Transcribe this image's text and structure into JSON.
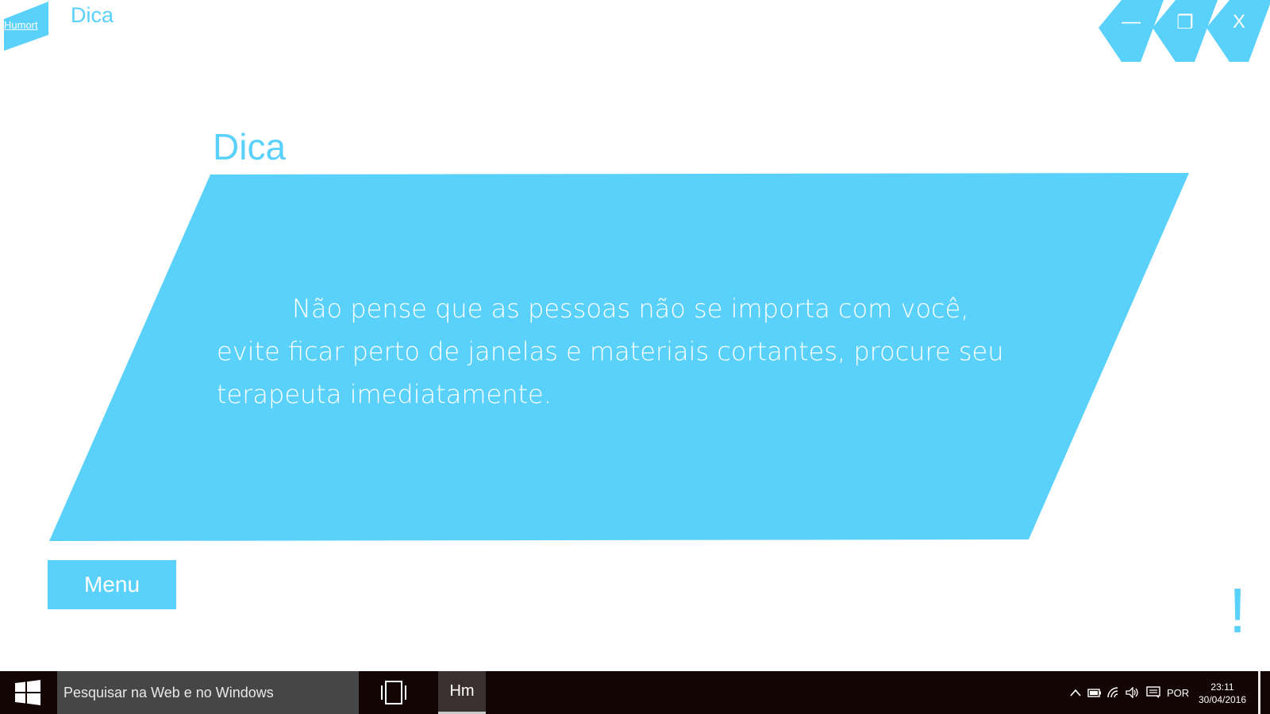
{
  "app": {
    "logo_text": "Humort",
    "window_title": "Dica",
    "controls": {
      "minimize": "—",
      "maximize": "❐",
      "close": "X"
    }
  },
  "page": {
    "heading": "Dica",
    "tip_text": "Não pense que as pessoas não se importa com você, evite ficar perto de janelas e materiais cortantes, procure seu terapeuta imediatamente.",
    "menu_button": "Menu",
    "alert_glyph": "!"
  },
  "taskbar": {
    "search_placeholder": "Pesquisar na Web e no Windows",
    "app_label": "Hm",
    "language": "POR",
    "time": "23:11",
    "date": "30/04/2016",
    "tray_icons": [
      "chevron-up-icon",
      "battery-icon",
      "wifi-icon",
      "volume-icon",
      "notifications-icon"
    ]
  },
  "colors": {
    "accent": "#5ad1fb",
    "background": "#ffffff",
    "taskbar": "#140505",
    "search": "#464646"
  }
}
